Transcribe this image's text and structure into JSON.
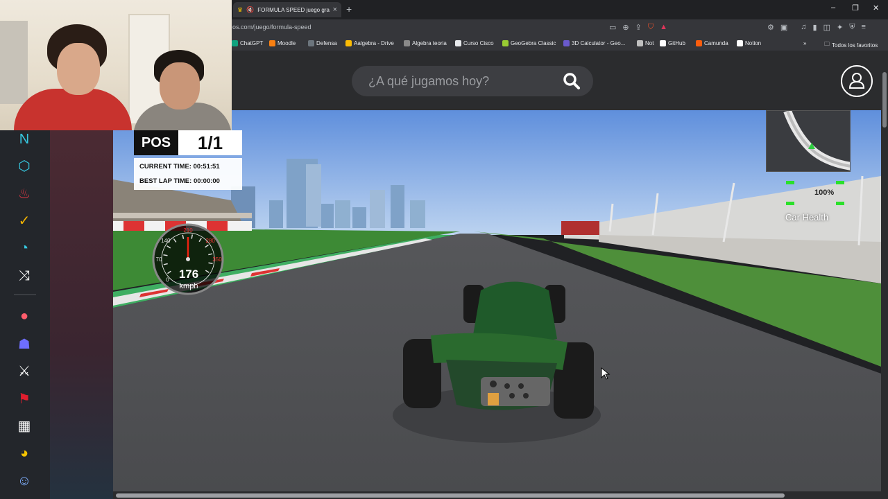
{
  "browser": {
    "tab_title": "FORMULA SPEED juego grati",
    "new_tab": "+",
    "url": "os.com/juego/formula-speed",
    "window_controls": [
      "–",
      "❐",
      "✕"
    ],
    "bookmarks": [
      {
        "label": "ChatGPT",
        "color": "#10a37f"
      },
      {
        "label": "Moodle",
        "color": "#f98012"
      },
      {
        "label": "Defensa",
        "color": "#6c757d"
      },
      {
        "label": "Aalgebra - Drive",
        "color": "#fbbc04"
      },
      {
        "label": "Algebra teoria",
        "color": "#8a8a8a"
      },
      {
        "label": "Curso Cisco",
        "color": "#e8eaed"
      },
      {
        "label": "GeoGebra Classic",
        "color": "#99cc33"
      },
      {
        "label": "3D Calculator - Geo...",
        "color": "#6a5acd"
      },
      {
        "label": "Not",
        "color": "#c0c0c0"
      },
      {
        "label": "GitHub",
        "color": "#ffffff"
      },
      {
        "label": "Camunda",
        "color": "#fc5d0d"
      },
      {
        "label": "Notion",
        "color": "#ffffff"
      }
    ],
    "bookmarks_more": "»",
    "all_favorites": "Todos los favoritos"
  },
  "site": {
    "search_placeholder": "¿A qué jugamos hoy?",
    "accent": "#36c8e0"
  },
  "sidebar": {
    "icons": [
      {
        "name": "new-games-icon",
        "glyph": "N",
        "color": "#36c8e0"
      },
      {
        "name": "network-icon",
        "glyph": "⬡",
        "color": "#36c8e0"
      },
      {
        "name": "trending-fire-icon",
        "glyph": "♨",
        "color": "#e63946"
      },
      {
        "name": "checkmark-icon",
        "glyph": "✓",
        "color": "#f4b400"
      },
      {
        "name": "speed-gauge-icon",
        "glyph": "◔",
        "color": "#36c8e0"
      },
      {
        "name": "shuffle-icon",
        "glyph": "⤨",
        "color": "#ffffff"
      },
      {
        "name": "dots-icon",
        "glyph": "●",
        "color": "#ff5d6c"
      },
      {
        "name": "two-players-icon",
        "glyph": "☗",
        "color": "#6e6eff"
      },
      {
        "name": "crossed-swords-icon",
        "glyph": "⚔",
        "color": "#ffffff"
      },
      {
        "name": "flag-icon",
        "glyph": "⚑",
        "color": "#e01e2e"
      },
      {
        "name": "racing-flag-icon",
        "glyph": "▦",
        "color": "#ffffff"
      },
      {
        "name": "pacman-icon",
        "glyph": "◕",
        "color": "#f4c300"
      },
      {
        "name": "kids-icon",
        "glyph": "☺",
        "color": "#7fb0ff"
      }
    ]
  },
  "game": {
    "pos_label": "POS",
    "pos_value": "1/1",
    "current_time": "CURRENT TIME: 00:51:51",
    "best_lap": "BEST LAP TIME: 00:00:00",
    "speed": "176",
    "speed_unit": "kmph",
    "speedo_ticks": [
      "210",
      "140",
      "280",
      "70",
      "350",
      "0"
    ],
    "car_health_pct": "100%",
    "car_health_label": "Car Health",
    "speed_fraction": 0.5
  }
}
